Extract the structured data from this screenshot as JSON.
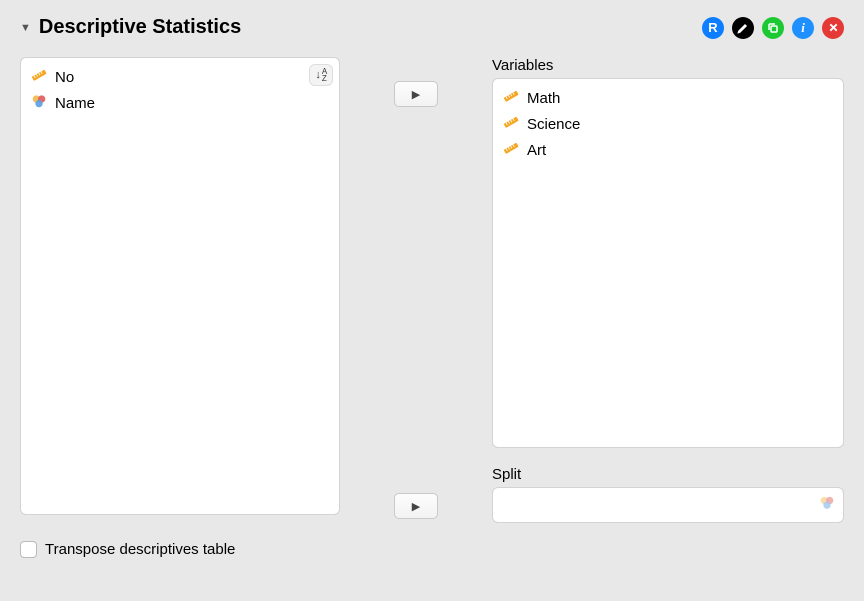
{
  "header": {
    "title": "Descriptive Statistics"
  },
  "available": {
    "items": [
      {
        "label": "No",
        "type": "scale"
      },
      {
        "label": "Name",
        "type": "nominal"
      }
    ]
  },
  "variables": {
    "label": "Variables",
    "items": [
      {
        "label": "Math",
        "type": "scale"
      },
      {
        "label": "Science",
        "type": "scale"
      },
      {
        "label": "Art",
        "type": "scale"
      }
    ]
  },
  "split": {
    "label": "Split"
  },
  "transpose": {
    "label": "Transpose descriptives table",
    "checked": false
  }
}
